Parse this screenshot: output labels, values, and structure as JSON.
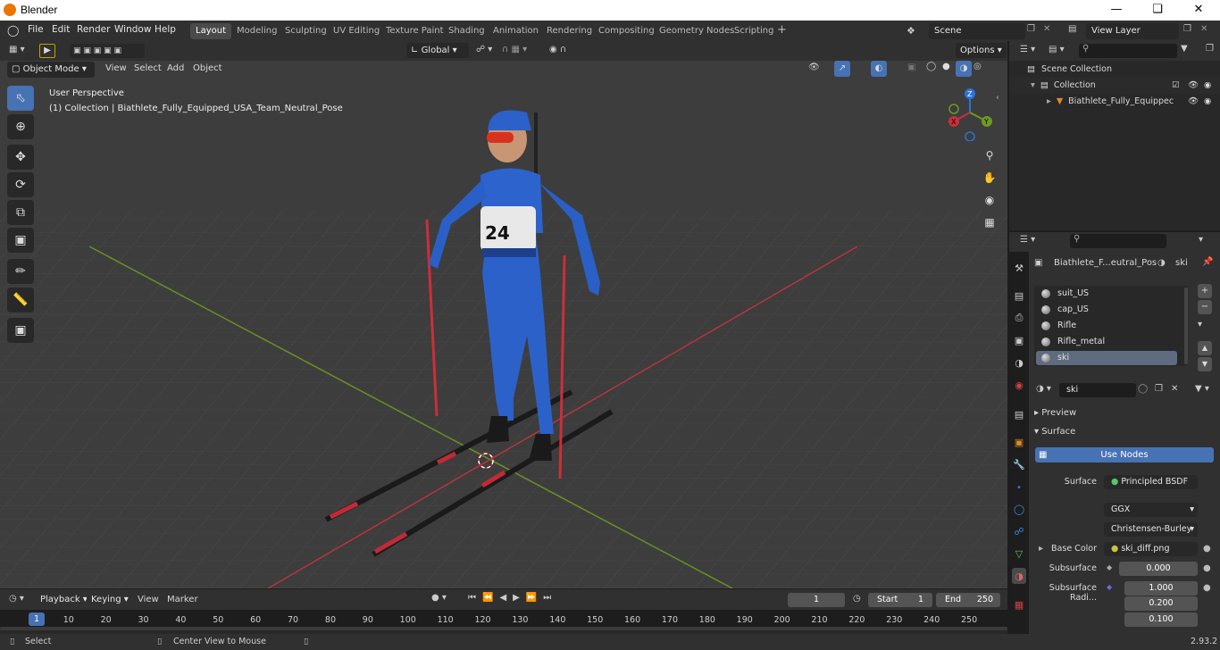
{
  "window": {
    "title": "Blender"
  },
  "topmenu": [
    "File",
    "Edit",
    "Render",
    "Window",
    "Help"
  ],
  "workspaces": [
    "Layout",
    "Modeling",
    "Sculpting",
    "UV Editing",
    "Texture Paint",
    "Shading",
    "Animation",
    "Rendering",
    "Compositing",
    "Geometry Nodes",
    "Scripting"
  ],
  "scene": {
    "name": "Scene",
    "view_layer": "View Layer"
  },
  "toolheader": {
    "orientation": "Global",
    "options": "Options"
  },
  "viewport_header": {
    "mode": "Object Mode",
    "menus": [
      "View",
      "Select",
      "Add",
      "Object"
    ]
  },
  "viewport": {
    "perspective": "User Perspective",
    "info": "(1) Collection | Biathlete_Fully_Equipped_USA_Team_Neutral_Pose",
    "bib_number": "24",
    "gizmo": {
      "z": "Z",
      "y": "Y",
      "x": "X"
    }
  },
  "outliner": {
    "root": "Scene Collection",
    "collection": "Collection",
    "object": "Biathlete_Fully_Equippec"
  },
  "properties": {
    "object_name": "Biathlete_F...eutral_Pos",
    "material_name": "ski",
    "materials": [
      "suit_US",
      "cap_US",
      "Rifle",
      "Rifle_metal",
      "ski"
    ],
    "selected_material": "ski",
    "slot_name": "ski",
    "sections": {
      "preview": "Preview",
      "surface": "Surface"
    },
    "use_nodes": "Use Nodes",
    "surface_label": "Surface",
    "surface_value": "Principled BSDF",
    "distribution": "GGX",
    "subsurface_method": "Christensen-Burley",
    "base_color_label": "Base Color",
    "base_color_value": "ski_diff.png",
    "subsurface_label": "Subsurface",
    "subsurface_value": "0.000",
    "subsurface_radius_label": "Subsurface Radi...",
    "subsurface_radius": [
      "1.000",
      "0.200",
      "0.100"
    ]
  },
  "timeline": {
    "menus": [
      "Playback",
      "Keying",
      "View",
      "Marker"
    ],
    "current_frame": "1",
    "start_label": "Start",
    "start": "1",
    "end_label": "End",
    "end": "250",
    "ticks": [
      "1",
      "10",
      "20",
      "30",
      "40",
      "50",
      "60",
      "70",
      "80",
      "90",
      "100",
      "110",
      "120",
      "130",
      "140",
      "150",
      "160",
      "170",
      "180",
      "190",
      "200",
      "210",
      "220",
      "230",
      "240",
      "250"
    ]
  },
  "status": {
    "left": "Select",
    "middle": "Center View to Mouse",
    "version": "2.93.2"
  },
  "colors": {
    "accent": "#4772b3",
    "axis_x": "#b8343f",
    "axis_y": "#6b8f23",
    "grid": "#454545"
  }
}
